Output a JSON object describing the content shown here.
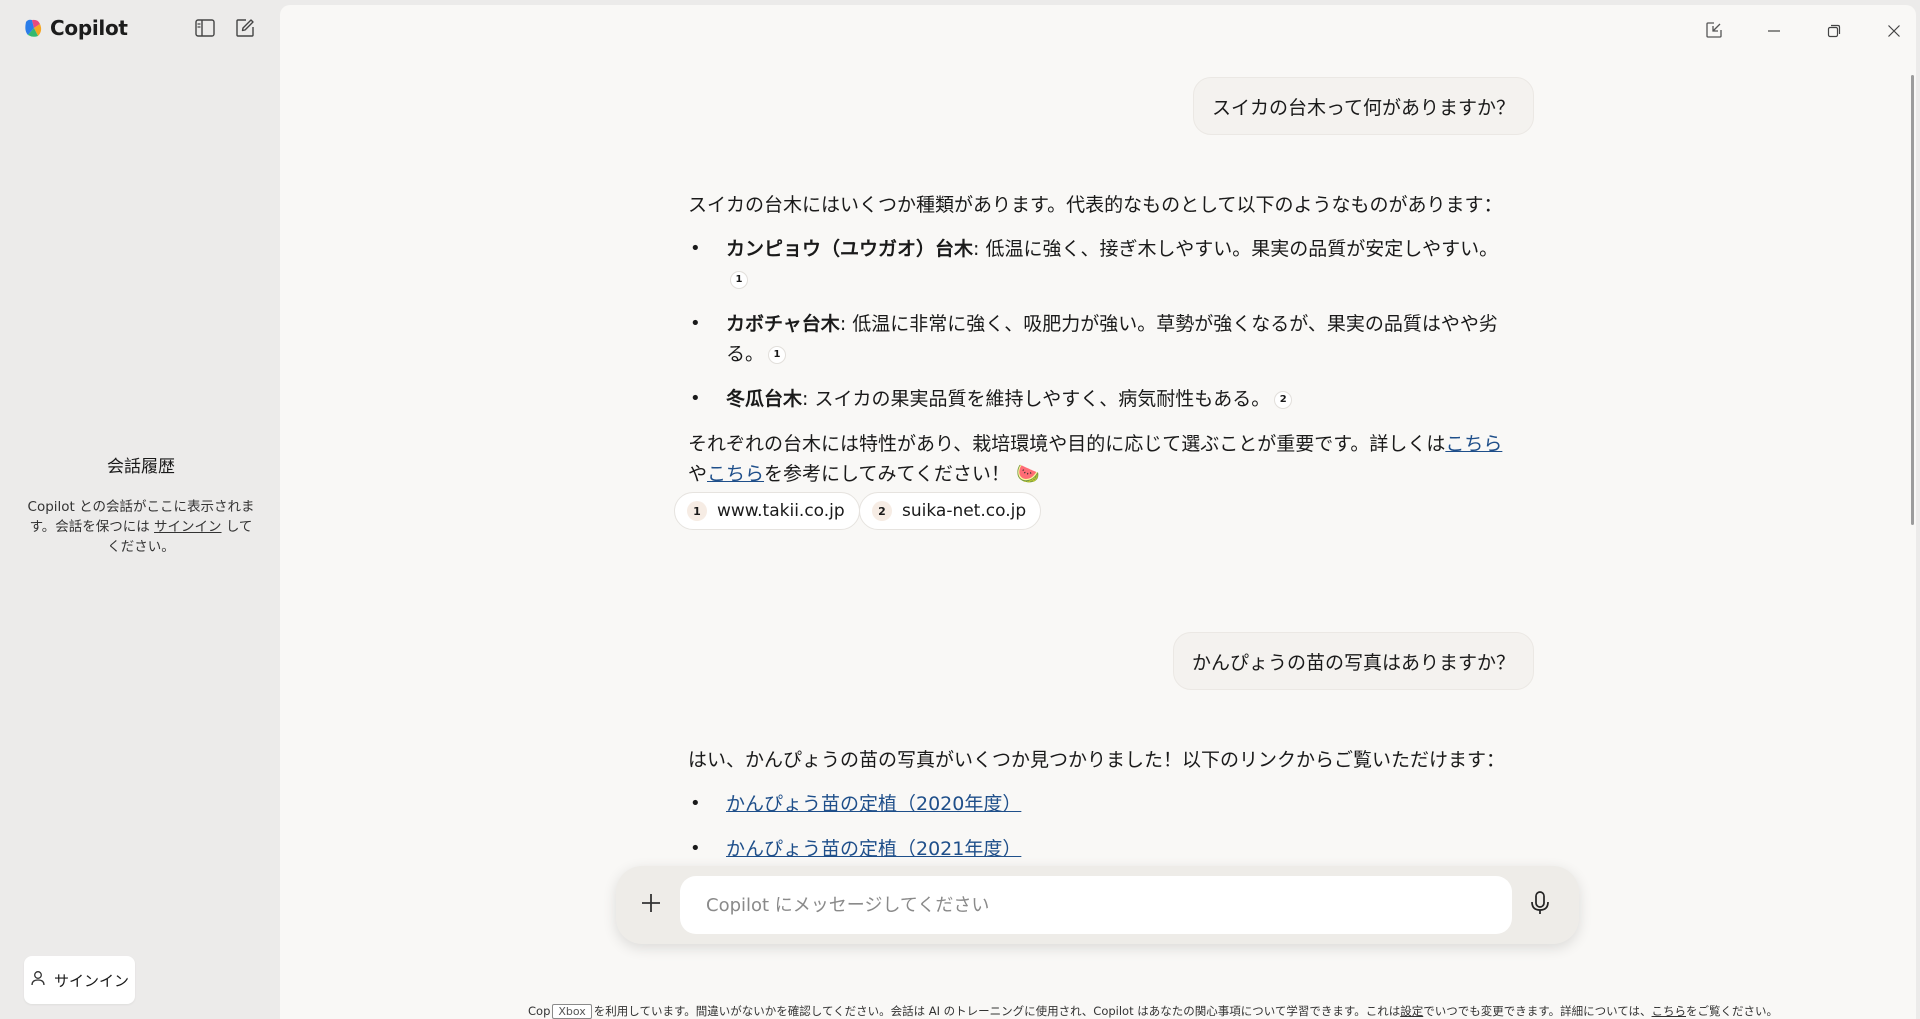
{
  "app": {
    "name": "Copilot"
  },
  "sidebar": {
    "history_title": "会話履歴",
    "history_desc_1": "Copilot との会話がここに表示されます。会話を保つには ",
    "history_desc_link": "サインイン",
    "history_desc_2": " してください。",
    "signin_label": "サインイン"
  },
  "conversation": {
    "q1": "スイカの台木って何がありますか？",
    "a1": {
      "intro": "スイカの台木にはいくつか種類があります。代表的なものとして以下のようなものがあります：",
      "items": [
        {
          "term": "カンピョウ（ユウガオ）台木",
          "text": ": 低温に強く、接ぎ木しやすい。果実の品質が安定しやすい。",
          "cite": "1"
        },
        {
          "term": "カボチャ台木",
          "text": ": 低温に非常に強く、吸肥力が強い。草勢が強くなるが、果実の品質はやや劣る。",
          "cite": "1"
        },
        {
          "term": "冬瓜台木",
          "text": ": スイカの果実品質を維持しやすく、病気耐性もある。",
          "cite": "2"
        }
      ],
      "outro_1": "それぞれの台木には特性があり、栽培環境や目的に応じて選ぶことが重要です。詳しくは",
      "link_1": "こちら",
      "outro_mid": "や",
      "link_2": "こちら",
      "outro_2": "を参考にしてみてください！",
      "emoji": "🍉",
      "sources": [
        {
          "num": "1",
          "domain": "www.takii.co.jp"
        },
        {
          "num": "2",
          "domain": "suika-net.co.jp"
        }
      ]
    },
    "q2": "かんぴょうの苗の写真はありますか？",
    "a2": {
      "intro": "はい、かんぴょうの苗の写真がいくつか見つかりました！以下のリンクからご覧いただけます：",
      "links": [
        "かんぴょう苗の定植（2020年度）",
        "かんぴょう苗の定植（2021年度）"
      ]
    }
  },
  "composer": {
    "placeholder": "Copilot にメッセージしてください"
  },
  "footer": {
    "prefix": "Cop",
    "tag": "Xbox",
    "text_1": "を利用しています。間違いがないかを確認してください。会話は AI のトレーニングに使用され、Copilot はあなたの関心事項について学習できます。これは",
    "settings_link": "設定",
    "text_2": "でいつでも変更できます。詳細については、",
    "more_link": "こちら",
    "text_3": "をご覧ください。"
  },
  "colors": {
    "link": "#1f4f8a",
    "main_bg": "#f9f8f6",
    "sidebar_bg": "#ecebea"
  }
}
